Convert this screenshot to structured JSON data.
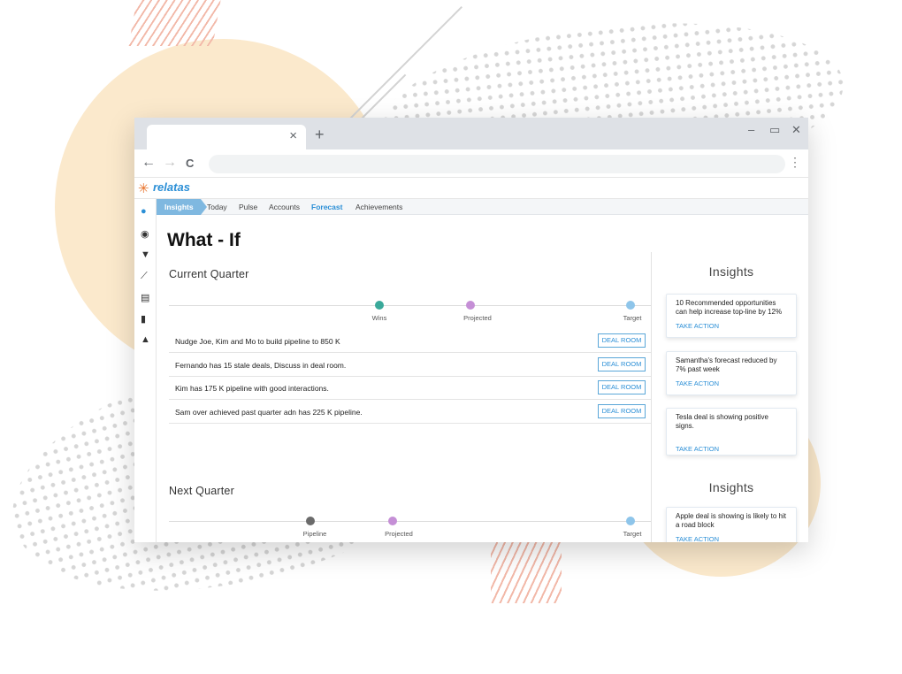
{
  "browser": {
    "tab_close": "×",
    "new_tab": "+",
    "minimize": "–",
    "maximize": "▭",
    "close": "✕",
    "back": "←",
    "forward": "→",
    "reload": "C",
    "menu": "⋮"
  },
  "app": {
    "logo": "relatas"
  },
  "nav": {
    "active": "Insights",
    "items": [
      "Today",
      "Pulse",
      "Accounts",
      "Forecast",
      "Achievements"
    ],
    "highlight_color": "#2b8fd6"
  },
  "page": {
    "title": "What - If"
  },
  "current_quarter": {
    "title": "Current Quarter",
    "markers": [
      {
        "label": "Wins",
        "color": "#3aa99a"
      },
      {
        "label": "Projected",
        "color": "#c58fd6"
      },
      {
        "label": "Target",
        "color": "#8ec5ea"
      }
    ],
    "actions": [
      {
        "text": "Nudge Joe, Kim and Mo to build pipeline to 850 K",
        "button": "DEAL ROOM"
      },
      {
        "text": "Fernando has 15 stale deals, Discuss in deal room.",
        "button": "DEAL ROOM"
      },
      {
        "text": "Kim has 175 K pipeline with good interactions.",
        "button": "DEAL ROOM"
      },
      {
        "text": "Sam over achieved past quarter adn has 225 K pipeline.",
        "button": "DEAL ROOM"
      }
    ]
  },
  "next_quarter": {
    "title": "Next Quarter",
    "markers": [
      {
        "label": "Pipeline",
        "color": "#6b6b6b"
      },
      {
        "label": "Projected",
        "color": "#c58fd6"
      },
      {
        "label": "Target",
        "color": "#8ec5ea"
      }
    ]
  },
  "insights_panels": [
    {
      "title": "Insights",
      "cards": [
        {
          "text": "10 Recommended opportunities can help increase top-line by 12%",
          "action": "TAKE ACTION"
        },
        {
          "text": "Samantha's forecast reduced by 7% past week",
          "action": "TAKE ACTION"
        },
        {
          "text": "Tesla deal is showing positive signs.",
          "action": "TAKE ACTION"
        }
      ]
    },
    {
      "title": "Insights",
      "cards": [
        {
          "text": "Apple deal is showing is likely to hit a road block",
          "action": "TAKE ACTION"
        }
      ]
    }
  ]
}
